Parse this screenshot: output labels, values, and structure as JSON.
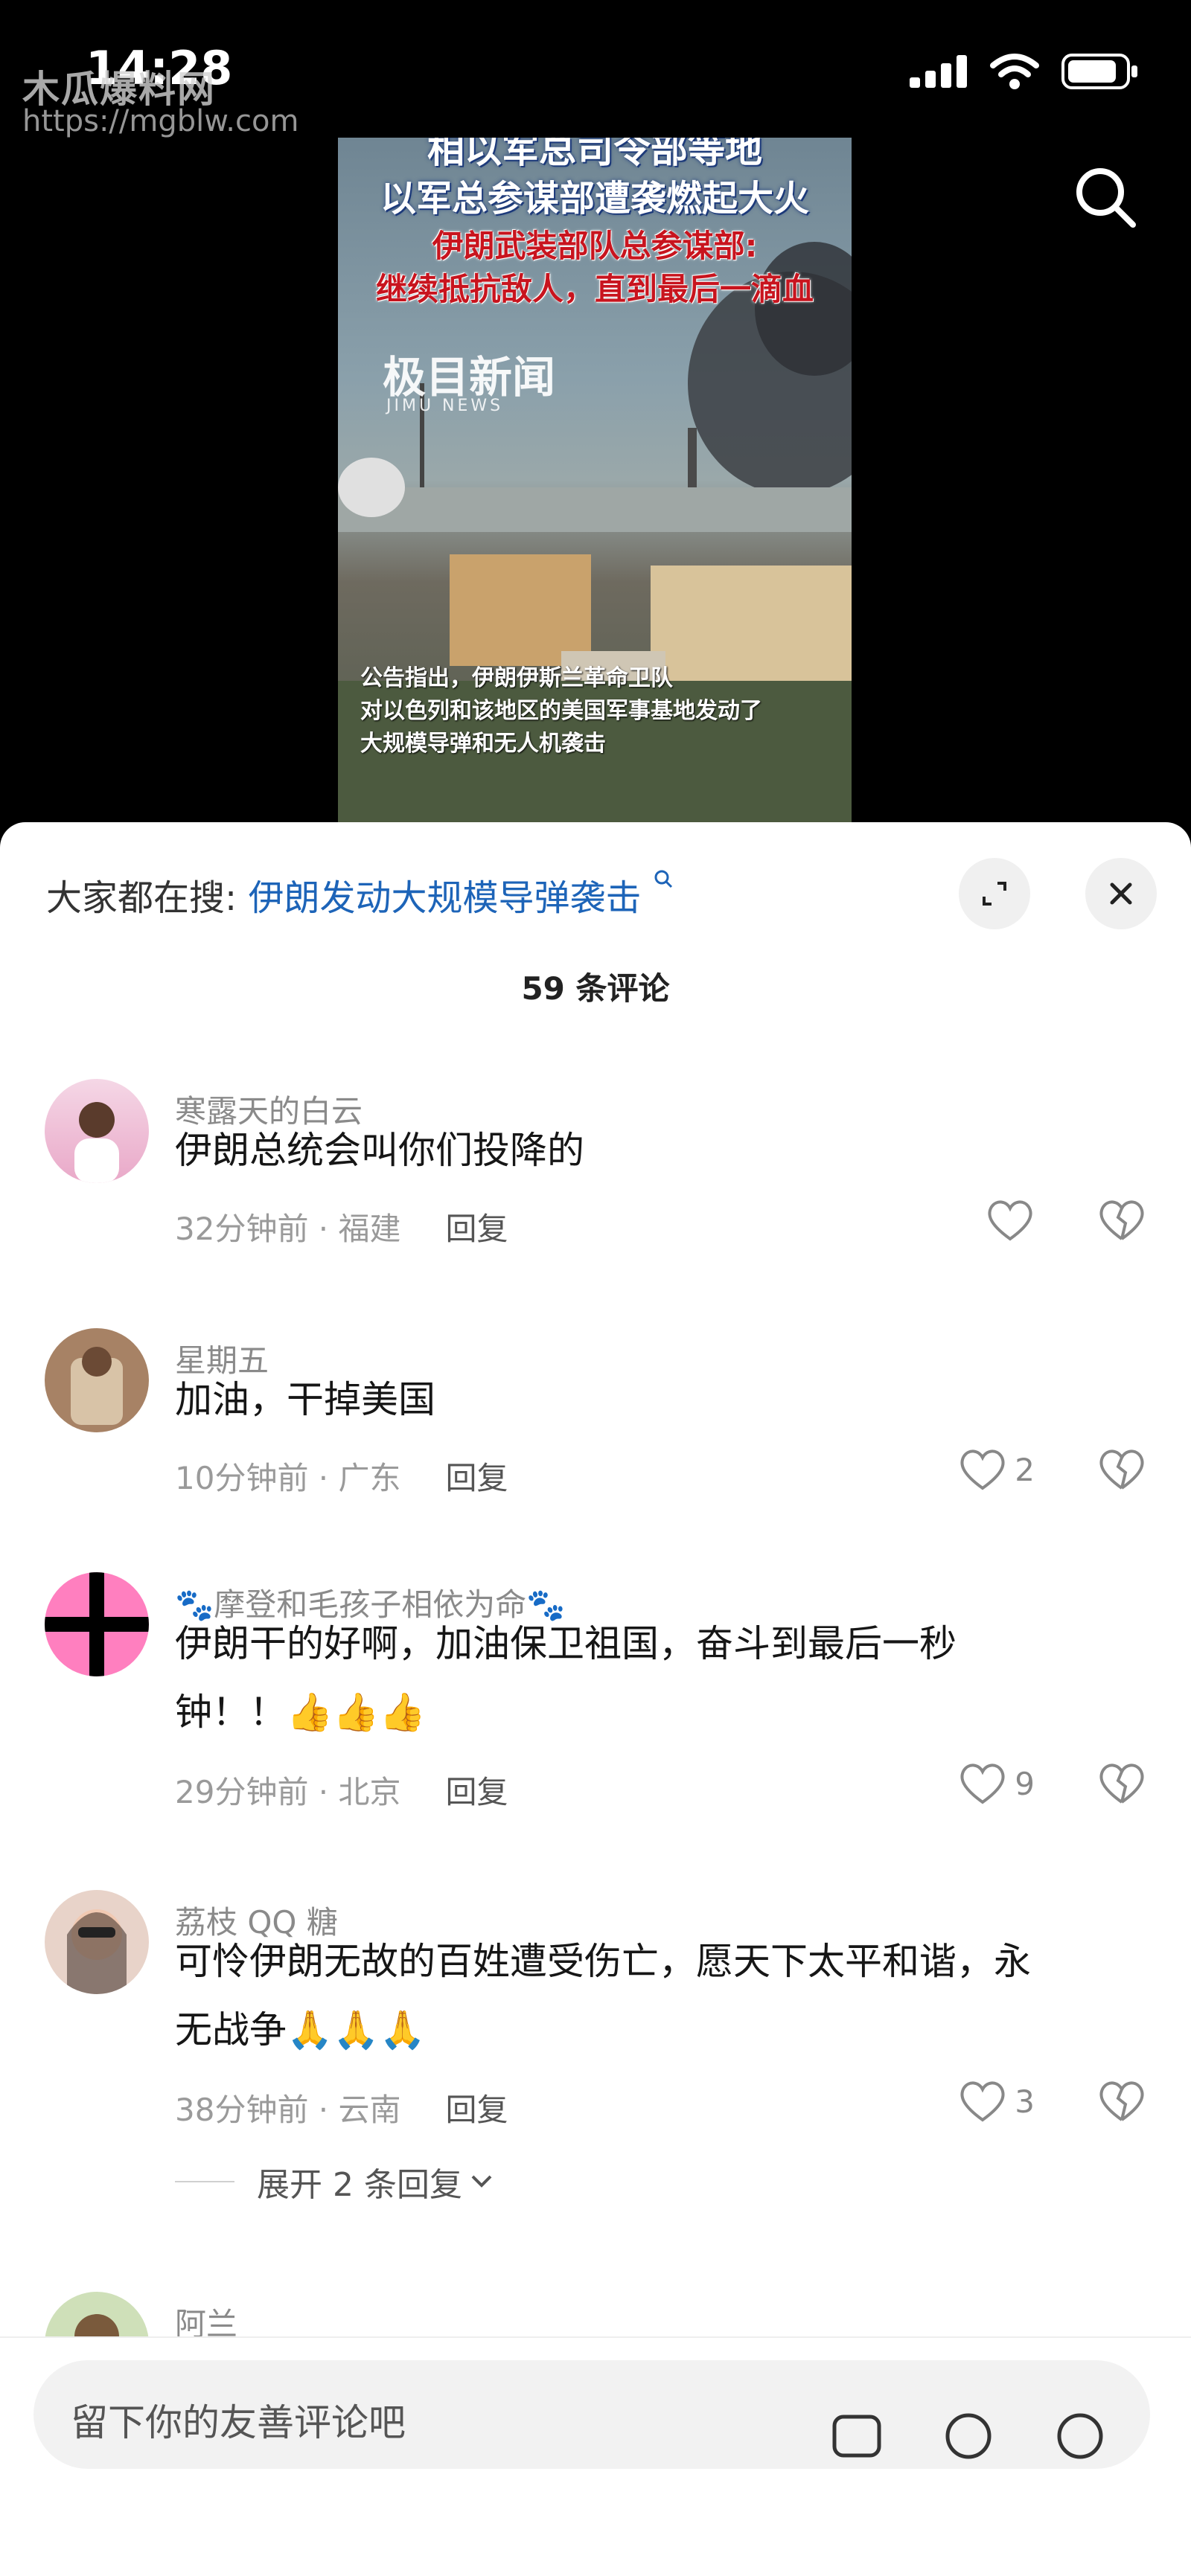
{
  "status": {
    "time": "14:28"
  },
  "watermark": {
    "name": "木瓜爆料网",
    "url": "https://mgblw.com"
  },
  "video": {
    "title_top": "相以军总司令部等地",
    "title_2": "以军总参谋部遭袭燃起大火",
    "red_1": "伊朗武装部队总参谋部:",
    "red_2": "继续抵抗敌人，直到最后一滴血",
    "logo": "极目新闻",
    "logo_sub": "JIMU NEWS",
    "caption_1": "公告指出，伊朗伊斯兰革命卫队",
    "caption_2": "对以色列和该地区的美国军事基地发动了",
    "caption_3": "大规模导弹和无人机袭击"
  },
  "sheet": {
    "search_prefix": "大家都在搜:",
    "search_query": "伊朗发动大规模导弹袭击",
    "count": "59 条评论"
  },
  "comments": [
    {
      "user": "寒露天的白云",
      "text": "伊朗总统会叫你们投降的",
      "time": "32分钟前 · 福建",
      "reply": "回复",
      "likes": ""
    },
    {
      "user": "星期五",
      "text": "加油，干掉美国",
      "time": "10分钟前 · 广东",
      "reply": "回复",
      "likes": "2"
    },
    {
      "user": "🐾摩登和毛孩子相依为命🐾",
      "text_1": "伊朗干的好啊，加油保卫祖国，奋斗到最后一秒",
      "text_2": "钟！！👍👍👍",
      "time": "29分钟前 · 北京",
      "reply": "回复",
      "likes": "9"
    },
    {
      "user": "荔枝 QQ 糖",
      "text_1": "可怜伊朗无故的百姓遭受伤亡，愿天下太平和谐，永",
      "text_2": "无战争🙏🙏🙏",
      "time": "38分钟前 · 云南",
      "reply": "回复",
      "likes": "3",
      "expand": "展开 2 条回复"
    },
    {
      "user": "阿兰"
    }
  ],
  "input": {
    "placeholder": "留下你的友善评论吧"
  }
}
